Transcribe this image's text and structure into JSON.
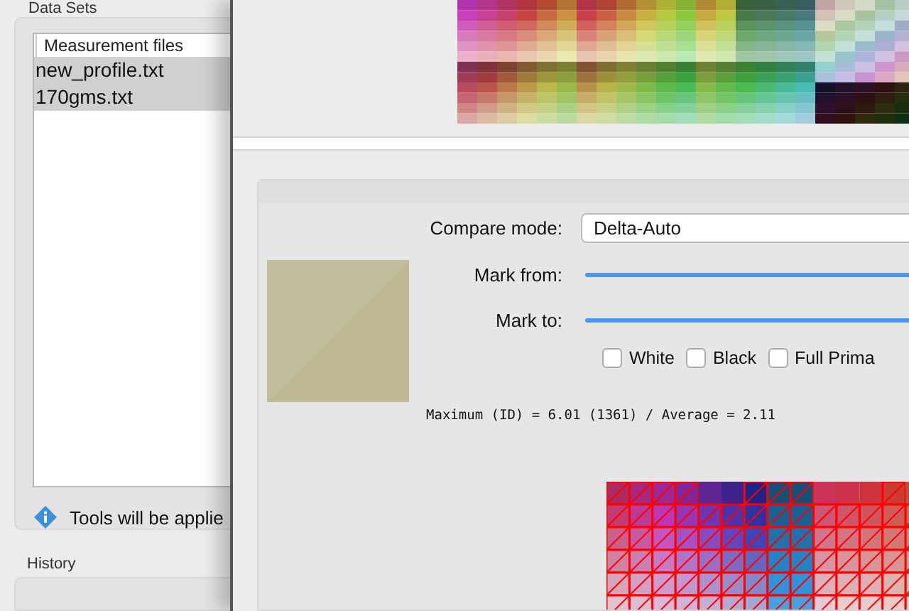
{
  "sidebar": {
    "section_title": "Data Sets",
    "list": {
      "column_header": "Measurement files",
      "rows": [
        {
          "label": "new_profile.txt",
          "selected": true
        },
        {
          "label": "170gms.txt",
          "selected": true
        }
      ]
    },
    "info_message": "Tools will be applie",
    "history_title": "History"
  },
  "compare": {
    "mode_label": "Compare mode:",
    "mode_value": "Delta-Auto",
    "sliders": [
      {
        "label": "Mark from:",
        "level": 1
      },
      {
        "label": "Mark to:",
        "level": 1
      }
    ],
    "checkboxes": [
      {
        "label": "White",
        "checked": false
      },
      {
        "label": "Black",
        "checked": false
      },
      {
        "label": "Full Prima",
        "checked": false
      }
    ],
    "summary": "Maximum (ID) = 6.01 (1361) / Average = 2.11"
  }
}
